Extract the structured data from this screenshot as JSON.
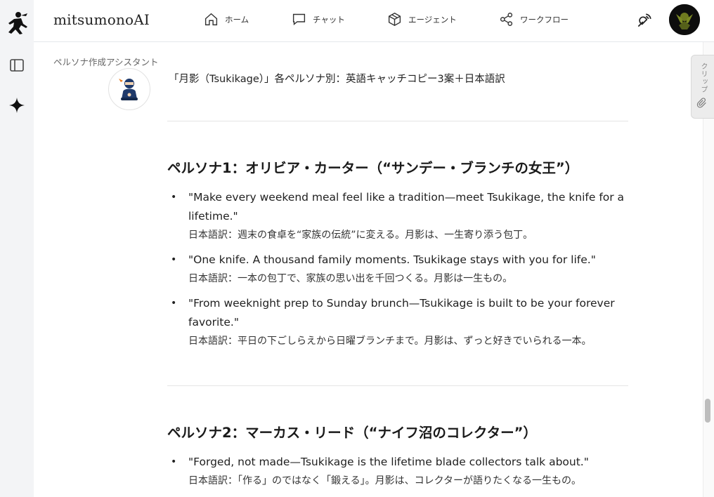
{
  "app": {
    "brand": "mitsumonoAI"
  },
  "nav": [
    {
      "label": "ホーム",
      "icon": "home-icon"
    },
    {
      "label": "チャット",
      "icon": "chat-icon"
    },
    {
      "label": "エージェント",
      "icon": "cube-icon"
    },
    {
      "label": "ワークフロー",
      "icon": "share-nodes-icon"
    }
  ],
  "sidebar": {
    "icons": [
      "ninja-logo-icon",
      "panel-toggle-icon",
      "sparkle-icon"
    ]
  },
  "clip_tab": {
    "label": "クリップ",
    "icon": "paperclip-icon"
  },
  "conversation": {
    "assistant_name": "ペルソナ作成アシスタント",
    "intro": "「月影（Tsukikage）」各ペルソナ別：英語キャッチコピー3案＋日本語訳",
    "personas": [
      {
        "heading": "ペルソナ1：オリビア・カーター（“サンデー・ブランチの女王”）",
        "items": [
          {
            "en": "\"Make every weekend meal feel like a tradition—meet Tsukikage, the knife for a lifetime.\"",
            "ja": "日本語訳：週末の食卓を“家族の伝統”に変える。月影は、一生寄り添う包丁。"
          },
          {
            "en": "\"One knife. A thousand family moments. Tsukikage stays with you for life.\"",
            "ja": "日本語訳：一本の包丁で、家族の思い出を千回つくる。月影は一生もの。"
          },
          {
            "en": "\"From weeknight prep to Sunday brunch—Tsukikage is built to be your forever favorite.\"",
            "ja": "日本語訳：平日の下ごしらえから日曜ブランチまで。月影は、ずっと好きでいられる一本。"
          }
        ]
      },
      {
        "heading": "ペルソナ2：マーカス・リード（“ナイフ沼のコレクター”）",
        "items": [
          {
            "en": "\"Forged, not made—Tsukikage is the lifetime blade collectors talk about.\"",
            "ja": "日本語訳：「作る」のではなく「鍛える」。月影は、コレクターが語りたくなる一生もの。"
          }
        ]
      }
    ]
  }
}
